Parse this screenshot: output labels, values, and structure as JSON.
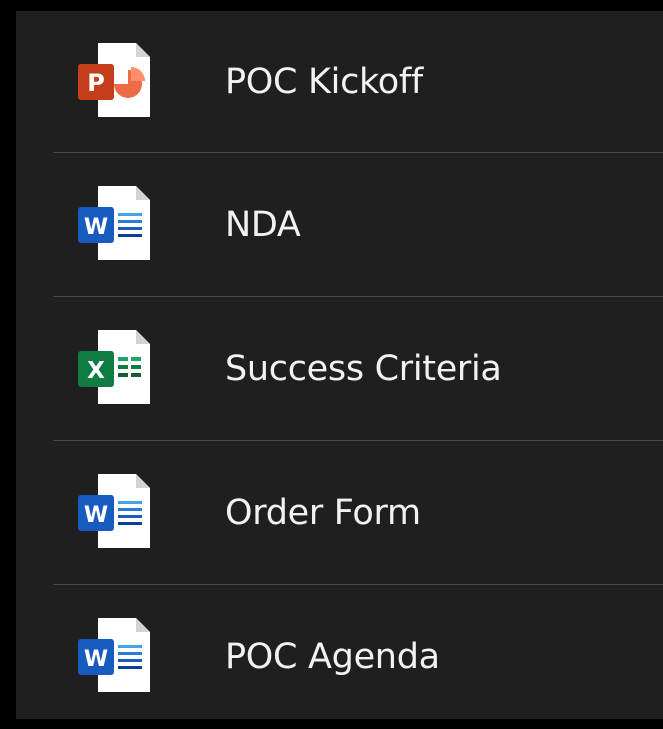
{
  "files": [
    {
      "name": "POC Kickoff",
      "icon": "powerpoint-file-icon",
      "app_letter": "P",
      "app_color": "#c43e1c"
    },
    {
      "name": "NDA",
      "icon": "word-file-icon",
      "app_letter": "W",
      "app_color": "#185abd"
    },
    {
      "name": "Success Criteria",
      "icon": "excel-file-icon",
      "app_letter": "X",
      "app_color": "#107c41"
    },
    {
      "name": "Order Form",
      "icon": "word-file-icon",
      "app_letter": "W",
      "app_color": "#185abd"
    },
    {
      "name": "POC Agenda",
      "icon": "word-file-icon",
      "app_letter": "W",
      "app_color": "#185abd"
    }
  ]
}
